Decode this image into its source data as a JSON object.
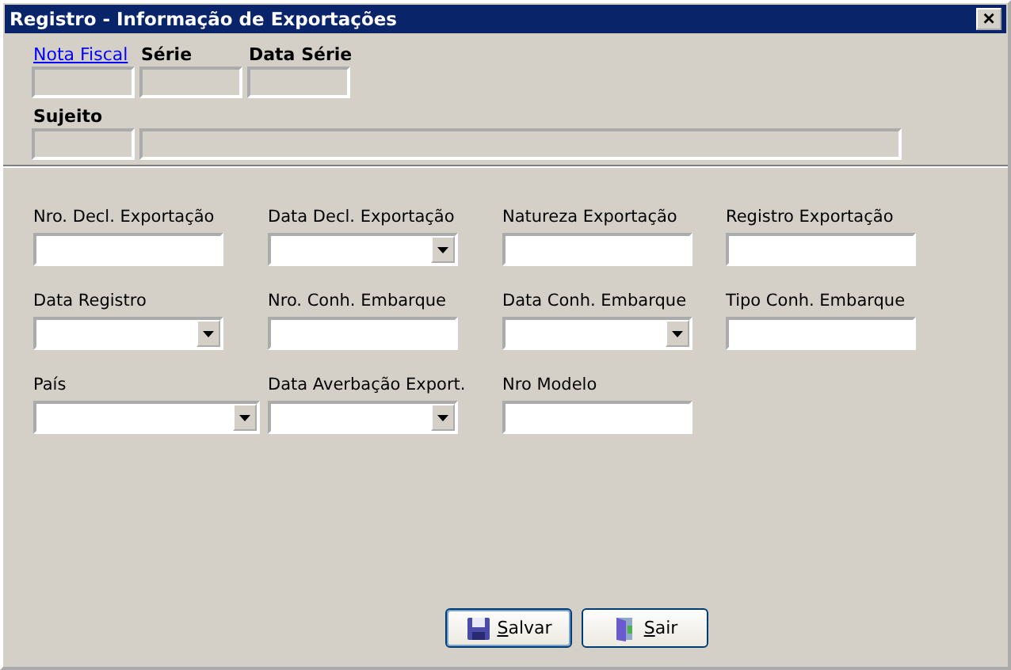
{
  "window": {
    "title": "Registro - Informação de Exportações",
    "close": "×"
  },
  "header": {
    "fields": [
      {
        "label": "Nota Fiscal",
        "kind": "link"
      },
      {
        "label": "Série",
        "kind": "bold"
      },
      {
        "label": "Data Série",
        "kind": "bold"
      }
    ],
    "subject": {
      "label": "Sujeito"
    }
  },
  "form": {
    "rows": [
      [
        {
          "label": "Nro. Decl. Exportação",
          "kind": "text"
        },
        {
          "label": "Data Decl. Exportação",
          "kind": "combo"
        },
        {
          "label": "Natureza Exportação",
          "kind": "text"
        },
        {
          "label": "Registro Exportação",
          "kind": "text"
        }
      ],
      [
        {
          "label": "Data Registro",
          "kind": "combo"
        },
        {
          "label": "Nro. Conh. Embarque",
          "kind": "text"
        },
        {
          "label": "Data Conh. Embarque",
          "kind": "combo"
        },
        {
          "label": "Tipo Conh. Embarque",
          "kind": "text"
        }
      ],
      [
        {
          "label": "País",
          "kind": "combo"
        },
        {
          "label": "Data Averbação Export.",
          "kind": "combo"
        },
        {
          "label": "Nro Modelo",
          "kind": "text"
        }
      ]
    ]
  },
  "buttons": [
    {
      "label": "Salvar",
      "kind": "save"
    },
    {
      "label": "Sair",
      "kind": "exit"
    }
  ]
}
